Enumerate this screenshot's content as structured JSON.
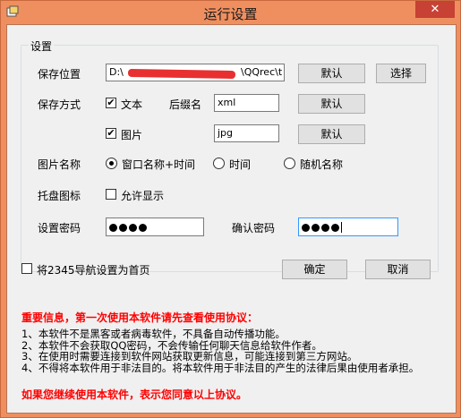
{
  "window": {
    "title": "运行设置",
    "close_glyph": "✕"
  },
  "group": {
    "legend": "设置"
  },
  "save_location": {
    "label": "保存位置",
    "path_prefix": "D:\\",
    "path_suffix": "\\QQrec\\t",
    "default_btn": "默认",
    "browse_btn": "选择"
  },
  "save_mode": {
    "label": "保存方式",
    "text_checkbox": "文本",
    "text_checked": true,
    "ext_label": "后缀名",
    "text_ext": "xml",
    "text_default_btn": "默认",
    "image_checkbox": "图片",
    "image_checked": true,
    "image_ext": "jpg",
    "image_default_btn": "默认"
  },
  "image_name": {
    "label": "图片名称",
    "options": [
      "窗口名称+时间",
      "时间",
      "随机名称"
    ],
    "selected": 0
  },
  "tray_icon": {
    "label": "托盘图标",
    "checkbox": "允许显示",
    "checked": false
  },
  "password": {
    "label": "设置密码",
    "confirm_label": "确认密码",
    "length": 4
  },
  "homepage": {
    "checkbox": "将2345导航设置为首页",
    "checked": false
  },
  "actions": {
    "ok": "确定",
    "cancel": "取消"
  },
  "notice": {
    "heading": "重要信息，第一次使用本软件请先查看使用协议：",
    "items": [
      "1、本软件不是黑客或者病毒软件，不具备自动传播功能。",
      "2、本软件不会获取QQ密码，不会传输任何聊天信息给软件作者。",
      "3、在使用时需要连接到软件网站获取更新信息，可能连接到第三方网站。",
      "4、不得将本软件用于非法目的。将本软件用于非法目的产生的法律后果由使用者承担。"
    ],
    "footer": "如果您继续使用本软件，表示您同意以上协议。"
  },
  "colors": {
    "frame": "#ef8f60",
    "close": "#c74134",
    "warning": "#ff0000",
    "accent": "#0078d7"
  }
}
